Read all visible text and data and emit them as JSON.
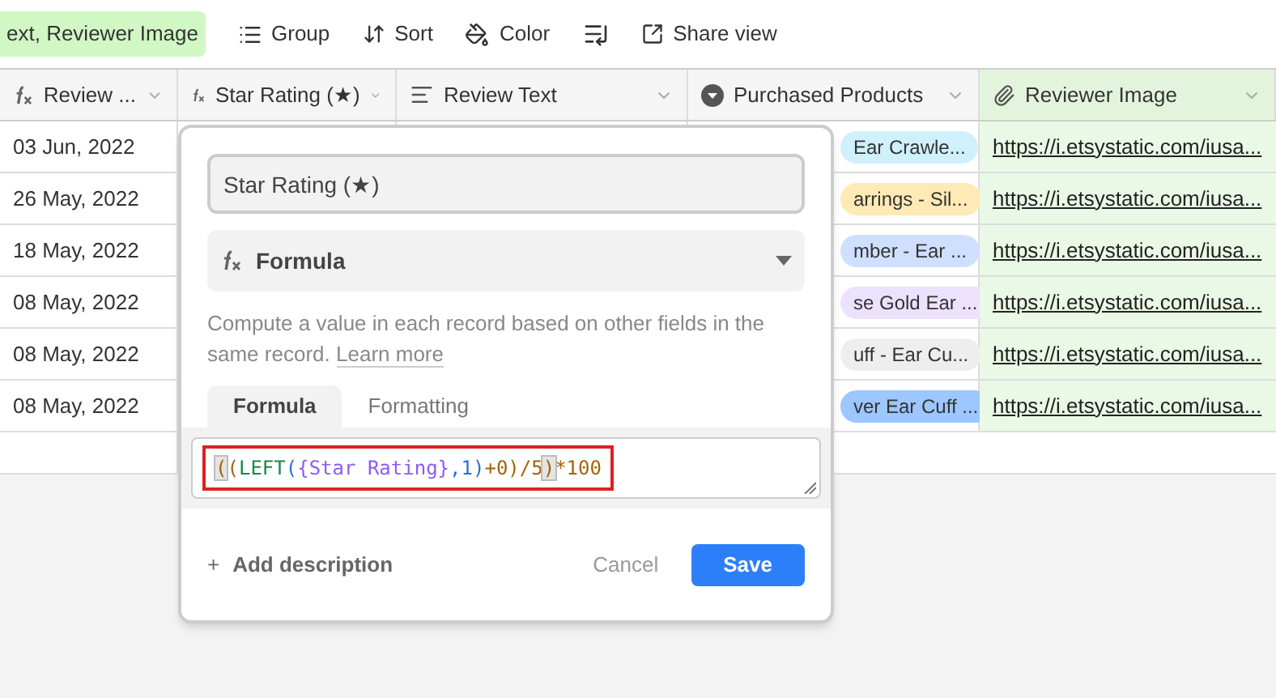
{
  "toolbar": {
    "filter_chip": "ext, Reviewer Image",
    "buttons": [
      {
        "kind": "group",
        "label": "Group"
      },
      {
        "kind": "sort",
        "label": "Sort"
      },
      {
        "kind": "color",
        "label": "Color"
      },
      {
        "kind": "row-height"
      },
      {
        "kind": "share",
        "label": "Share view"
      }
    ]
  },
  "table": {
    "columns": [
      {
        "kind": "formula",
        "label": "Review ...",
        "highlighted": false
      },
      {
        "kind": "formula",
        "label": "Star Rating (★)",
        "highlighted": false
      },
      {
        "kind": "text",
        "label": "Review Text",
        "highlighted": false
      },
      {
        "kind": "select",
        "label": "Purchased Products",
        "highlighted": false
      },
      {
        "kind": "attachment",
        "label": "Reviewer Image",
        "highlighted": true
      }
    ],
    "rows": [
      {
        "date": "03 Jun, 2022",
        "product": {
          "label": "Ear Crawle...",
          "color": "#d0f0fd"
        },
        "image": "https://i.etsystatic.com/iusa..."
      },
      {
        "date": "26 May, 2022",
        "product": {
          "label": "arrings - Sil...",
          "color": "#ffeab6"
        },
        "image": "https://i.etsystatic.com/iusa..."
      },
      {
        "date": "18 May, 2022",
        "product": {
          "label": "mber - Ear ...",
          "color": "#cfdfff"
        },
        "image": "https://i.etsystatic.com/iusa..."
      },
      {
        "date": "08 May, 2022",
        "product": {
          "label": "se Gold Ear ...",
          "color": "#ede2fe"
        },
        "image": "https://i.etsystatic.com/iusa..."
      },
      {
        "date": "08 May, 2022",
        "product": {
          "label": "uff - Ear Cu...",
          "color": "#eeeeee"
        },
        "image": "https://i.etsystatic.com/iusa..."
      },
      {
        "date": "08 May, 2022",
        "product": {
          "label": "ver Ear Cuff ...",
          "color": "#9cc7ff"
        },
        "image": "https://i.etsystatic.com/iusa..."
      }
    ]
  },
  "dialog": {
    "field_name": "Star Rating (★)",
    "field_type": "Formula",
    "description": "Compute a value in each record based on other fields in the same record.",
    "learn_more": "Learn more",
    "tabs": [
      {
        "label": "Formula",
        "selected": true
      },
      {
        "label": "Formatting",
        "selected": false
      }
    ],
    "formula": [
      {
        "text": "(",
        "color": "#a0650a",
        "matched": true
      },
      {
        "text": "(",
        "color": "#a0650a",
        "matched": false
      },
      {
        "text": "LEFT",
        "color": "#1a8a4a",
        "matched": false
      },
      {
        "text": "(",
        "color": "#2f6fd6",
        "matched": false
      },
      {
        "text": "{Star Rating}",
        "color": "#8b5cf6",
        "matched": false
      },
      {
        "text": ",1)",
        "color": "#2f6fd6",
        "matched": false
      },
      {
        "text": "+0)/5",
        "color": "#a0650a",
        "matched": false
      },
      {
        "text": ")",
        "color": "#a0650a",
        "matched": true
      },
      {
        "text": "*100",
        "color": "#a0650a",
        "matched": false
      }
    ],
    "add_description": "Add description",
    "add_icon": "+",
    "cancel": "Cancel",
    "save": "Save"
  }
}
